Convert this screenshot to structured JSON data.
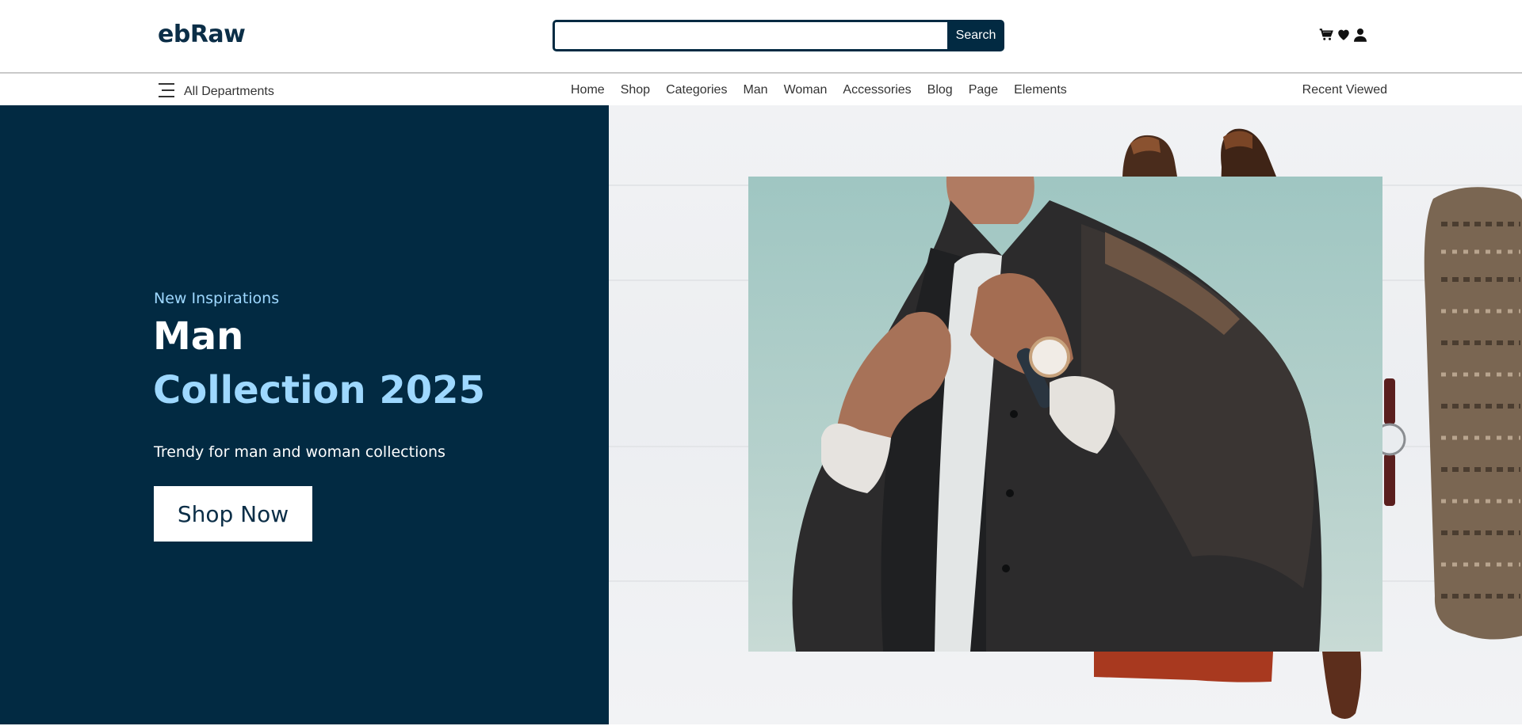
{
  "header": {
    "logo": "ebRaw",
    "search": {
      "value": "",
      "placeholder": "",
      "button_label": "Search"
    },
    "icons": [
      "cart-icon",
      "heart-icon",
      "user-icon"
    ]
  },
  "nav": {
    "departments_label": "All Departments",
    "menu": [
      {
        "label": "Home"
      },
      {
        "label": "Shop"
      },
      {
        "label": "Categories"
      },
      {
        "label": "Man"
      },
      {
        "label": "Woman"
      },
      {
        "label": "Accessories"
      },
      {
        "label": "Blog"
      },
      {
        "label": "Page"
      },
      {
        "label": "Elements"
      }
    ],
    "recent_label": "Recent Viewed"
  },
  "hero": {
    "kicker": "New Inspirations",
    "title_line1": "Man",
    "title_line2": "Collection 2025",
    "subtitle": "Trendy for man and woman collections",
    "cta_label": "Shop Now"
  },
  "colors": {
    "brand_dark": "#022a42",
    "accent_light_blue": "#9ed8ff",
    "white": "#ffffff"
  }
}
